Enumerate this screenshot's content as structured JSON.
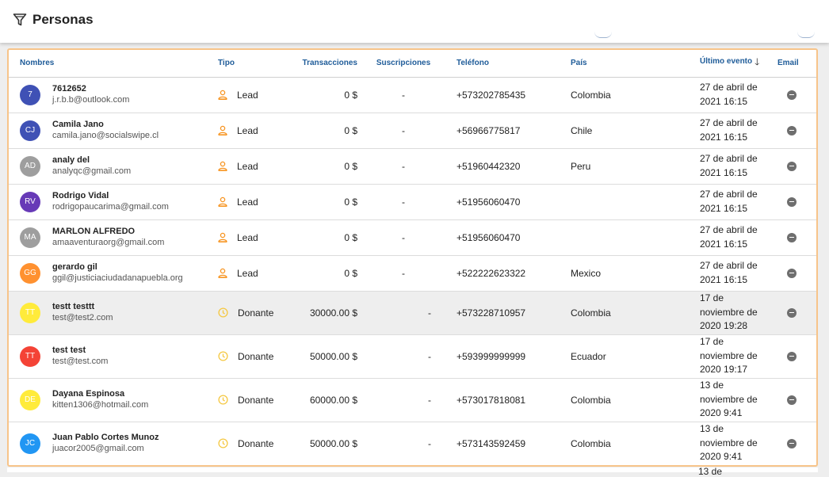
{
  "header": {
    "title": "Personas",
    "filter_icon": "filter-icon"
  },
  "table": {
    "columns": {
      "nombres": "Nombres",
      "tipo": "Tipo",
      "transacciones": "Transacciones",
      "suscripciones": "Suscripciones",
      "telefono": "Teléfono",
      "pais": "País",
      "ultimo_evento": "Último evento",
      "email": "Email"
    },
    "sort_icon": "arrow-down-icon",
    "rows": [
      {
        "initials": "7",
        "avatar_color": "#3f51b5",
        "name": "7612652",
        "email": "j.r.b.b@outlook.com",
        "tipo": "Lead",
        "transacciones": "0 $",
        "suscripciones": "-",
        "telefono": "+573202785435",
        "pais": "Colombia",
        "fecha1": "27 de abril de",
        "fecha2": "2021 16:15",
        "fecha3": ""
      },
      {
        "initials": "CJ",
        "avatar_color": "#3f51b5",
        "name": "Camila Jano",
        "email": "camila.jano@socialswipe.cl",
        "tipo": "Lead",
        "transacciones": "0 $",
        "suscripciones": "-",
        "telefono": "+56966775817",
        "pais": "Chile",
        "fecha1": "27 de abril de",
        "fecha2": "2021 16:15",
        "fecha3": ""
      },
      {
        "initials": "AD",
        "avatar_color": "#9e9e9e",
        "name": "analy del",
        "email": "analyqc@gmail.com",
        "tipo": "Lead",
        "transacciones": "0 $",
        "suscripciones": "-",
        "telefono": "+51960442320",
        "pais": "Peru",
        "fecha1": "27 de abril de",
        "fecha2": "2021 16:15",
        "fecha3": ""
      },
      {
        "initials": "RV",
        "avatar_color": "#673ab7",
        "name": "Rodrigo Vidal",
        "email": "rodrigopaucarima@gmail.com",
        "tipo": "Lead",
        "transacciones": "0 $",
        "suscripciones": "-",
        "telefono": "+51956060470",
        "pais": "",
        "fecha1": "27 de abril de",
        "fecha2": "2021 16:15",
        "fecha3": ""
      },
      {
        "initials": "MA",
        "avatar_color": "#9e9e9e",
        "name": "MARLON ALFREDO",
        "email": "amaaventuraorg@gmail.com",
        "tipo": "Lead",
        "transacciones": "0 $",
        "suscripciones": "-",
        "telefono": "+51956060470",
        "pais": "",
        "fecha1": "27 de abril de",
        "fecha2": "2021 16:15",
        "fecha3": ""
      },
      {
        "initials": "GG",
        "avatar_color": "#ff9130",
        "name": "gerardo gil",
        "email": "ggil@justiciaciudadanapuebla.org",
        "tipo": "Lead",
        "transacciones": "0 $",
        "suscripciones": "-",
        "telefono": "+522222623322",
        "pais": "Mexico",
        "fecha1": "27 de abril de",
        "fecha2": "2021 16:15",
        "fecha3": ""
      },
      {
        "initials": "TT",
        "avatar_color": "#ffeb3b",
        "name": "testt testtt",
        "email": "test@test2.com",
        "tipo": "Donante",
        "transacciones": "30000.00 $",
        "suscripciones": "-",
        "telefono": "+573228710957",
        "pais": "Colombia",
        "fecha1": "17 de",
        "fecha2": "noviembre de",
        "fecha3": "2020 19:28"
      },
      {
        "initials": "TT",
        "avatar_color": "#f44336",
        "name": "test test",
        "email": "test@test.com",
        "tipo": "Donante",
        "transacciones": "50000.00 $",
        "suscripciones": "-",
        "telefono": "+593999999999",
        "pais": "Ecuador",
        "fecha1": "17 de",
        "fecha2": "noviembre de",
        "fecha3": "2020 19:17"
      },
      {
        "initials": "DE",
        "avatar_color": "#ffeb3b",
        "name": "Dayana Espinosa",
        "email": "kitten1306@hotmail.com",
        "tipo": "Donante",
        "transacciones": "60000.00 $",
        "suscripciones": "-",
        "telefono": "+573017818081",
        "pais": "Colombia",
        "fecha1": "13 de",
        "fecha2": "noviembre de",
        "fecha3": "2020 9:41"
      },
      {
        "initials": "JC",
        "avatar_color": "#2196f3",
        "name": "Juan Pablo Cortes Munoz",
        "email": "juacor2005@gmail.com",
        "tipo": "Donante",
        "transacciones": "50000.00 $",
        "suscripciones": "-",
        "telefono": "+573143592459",
        "pais": "Colombia",
        "fecha1": "13 de",
        "fecha2": "noviembre de",
        "fecha3": "2020 9:41"
      }
    ],
    "next_row_partial": "13 de"
  },
  "colors": {
    "accent": "#1f5c99",
    "lead_icon": "#f7931e",
    "donante_icon": "#f5c842",
    "panel_border": "#f7c48a",
    "highlight_row": "#eeeeee"
  }
}
